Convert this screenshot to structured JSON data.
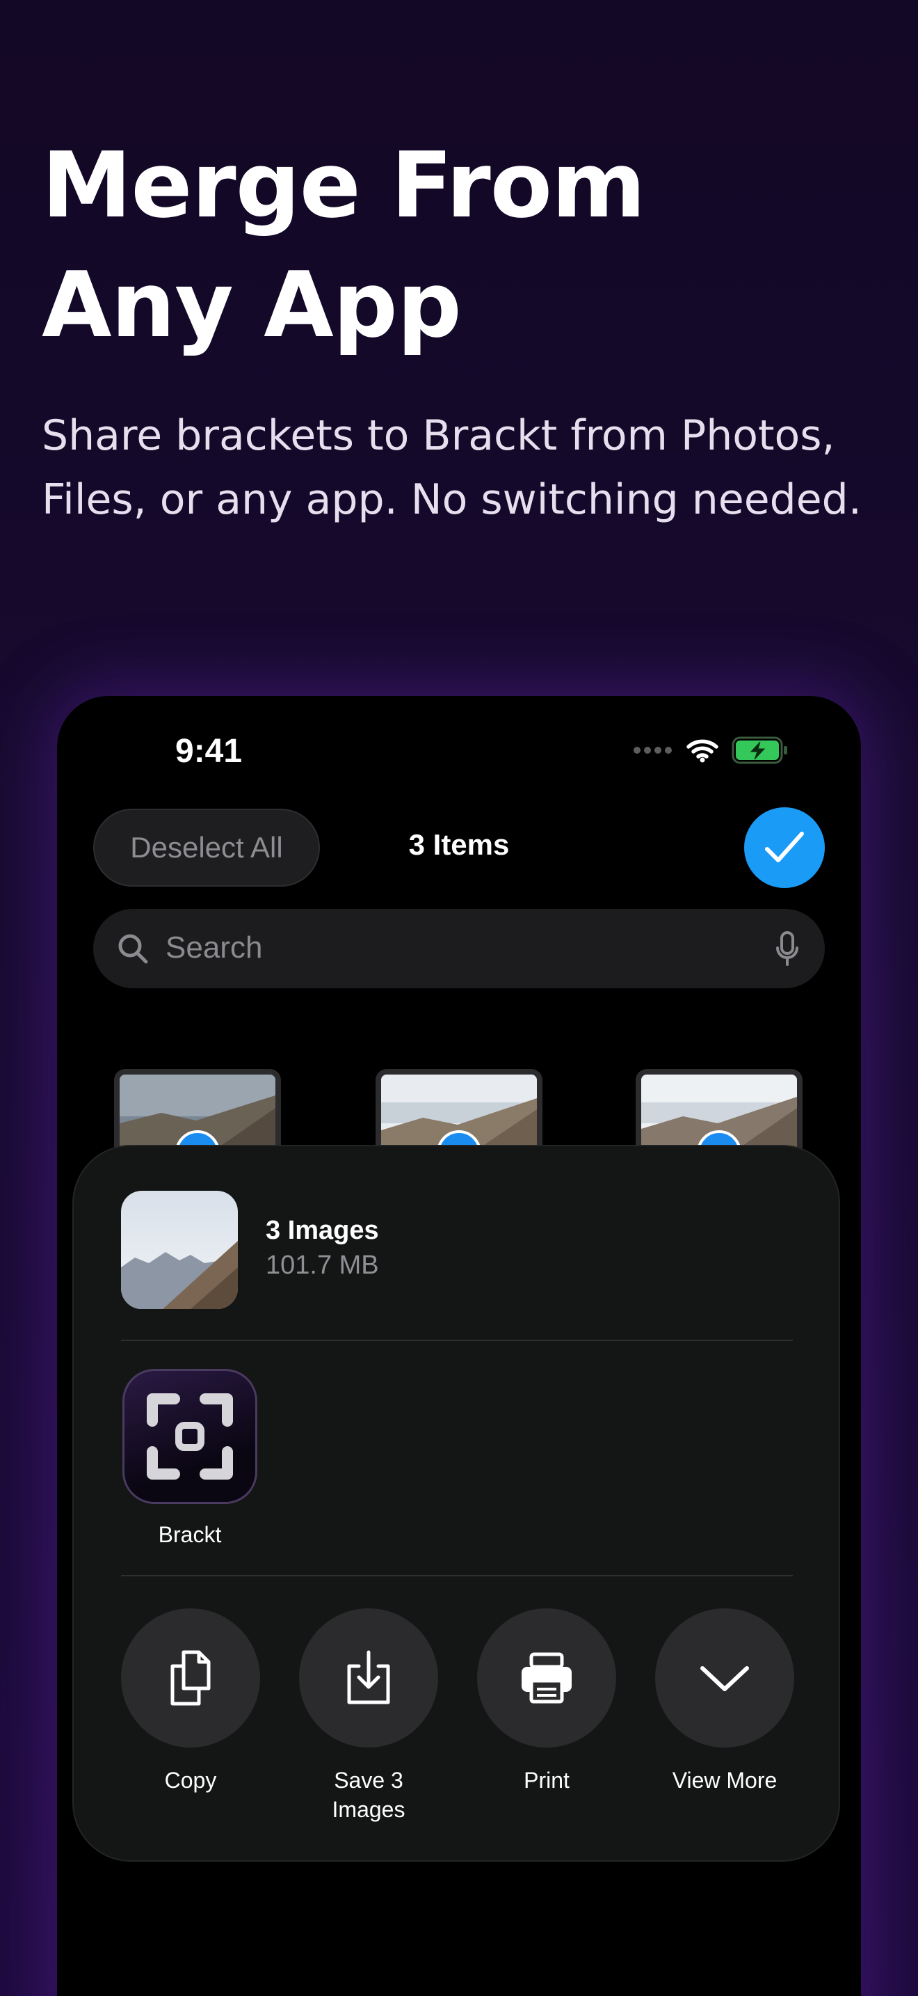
{
  "headline": {
    "line1": "Merge From",
    "line2": "Any App"
  },
  "subhead": {
    "line1": "Share brackets to Brackt from Photos,",
    "line2": "Files, or any app. No switching needed."
  },
  "status_bar": {
    "time": "9:41"
  },
  "picker": {
    "deselect_label": "Deselect All",
    "title": "3 Items",
    "search_placeholder": "Search"
  },
  "share_sheet": {
    "file_title": "3 Images",
    "file_size": "101.7 MB",
    "apps": [
      {
        "label": "Brackt",
        "icon": "brackt-app-icon"
      }
    ],
    "actions": [
      {
        "label": "Copy",
        "icon": "copy-icon"
      },
      {
        "label": "Save 3\nImages",
        "icon": "save-icon"
      },
      {
        "label": "Print",
        "icon": "print-icon"
      },
      {
        "label": "View More",
        "icon": "chevron-down-icon"
      }
    ]
  },
  "colors": {
    "background": "#150828",
    "accent": "#1a9bf5",
    "sheet": "#141515",
    "battery": "#34c759"
  }
}
